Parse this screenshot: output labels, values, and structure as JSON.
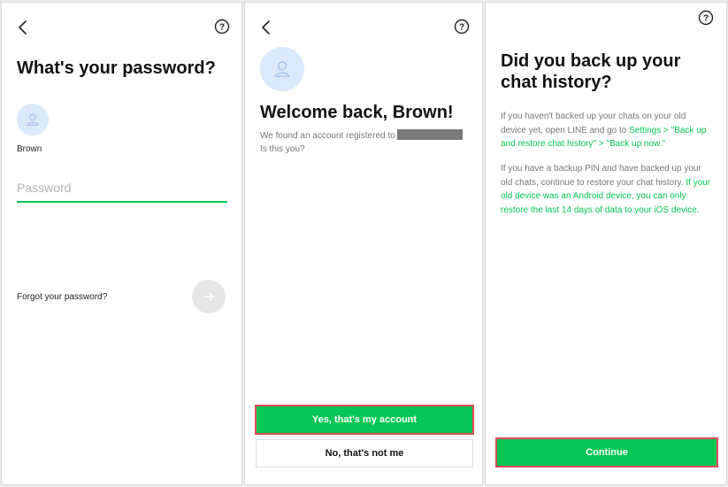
{
  "screen1": {
    "title": "What's your password?",
    "username": "Brown",
    "password_placeholder": "Password",
    "forgot_label": "Forgot your password?"
  },
  "screen2": {
    "title": "Welcome back, Brown!",
    "found_text": "We found an account registered to",
    "question": "Is this you?",
    "confirm_label": "Yes, that's my account",
    "deny_label": "No, that's not me"
  },
  "screen3": {
    "title_line1": "Did you back up your",
    "title_line2": "chat history?",
    "para1_text": "If you haven't backed up your chats on your old device yet, open LINE and go to ",
    "para1_link": "Settings > \"Back up and restore chat history\" > \"Back up now.\"",
    "para2_text": "If you have a backup PIN and have backed up your old chats, continue to restore your chat history. ",
    "para2_note": "If your old device was an Android device, you can only restore the last 14 days of data to your iOS device.",
    "continue_label": "Continue"
  },
  "icons": {
    "back": "chevron-left-icon",
    "help": "help-icon",
    "avatar": "user-icon",
    "next": "arrow-right-icon"
  },
  "colors": {
    "accent": "#06c755",
    "highlight_border": "#e0495b",
    "avatar_bg": "#dce8fb",
    "avatar_fg": "#a9c3ee",
    "redaction": "#7a7a7a"
  }
}
